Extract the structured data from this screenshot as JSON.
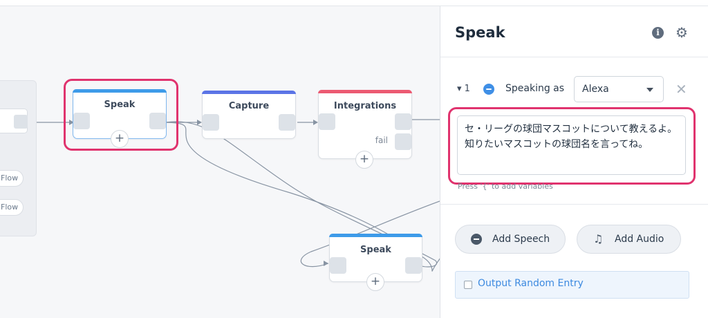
{
  "canvas": {
    "flow_pills": [
      "Flow",
      "Flow"
    ],
    "nodes": {
      "speak_main": {
        "title": "Speak",
        "color": "#3e9be9"
      },
      "capture": {
        "title": "Capture",
        "color": "#5b74e6"
      },
      "integrations": {
        "title": "Integrations",
        "fail_label": "fail",
        "color": "#ec5a72"
      },
      "speak_lower": {
        "title": "Speak",
        "color": "#3e9be9"
      }
    },
    "plus_glyph": "+"
  },
  "panel": {
    "title": "Speak",
    "info_icon": "i",
    "settings_icon": "⚙",
    "step": {
      "toggle": "▾ 1",
      "speaking_label": "Speaking as",
      "voice_value": "Alexa",
      "remove_icon": "✕"
    },
    "text_value": "セ・リーグの球団マスコットについて教えるよ。知りたいマスコットの球団名を言ってね。",
    "hint": "Press '{' to add variables",
    "add_speech": "Add Speech",
    "add_audio": "Add Audio",
    "music_icon": "♫",
    "random_label": "Output Random Entry"
  },
  "colors": {
    "highlight": "#e0336e",
    "accent": "#3d8ae0"
  }
}
